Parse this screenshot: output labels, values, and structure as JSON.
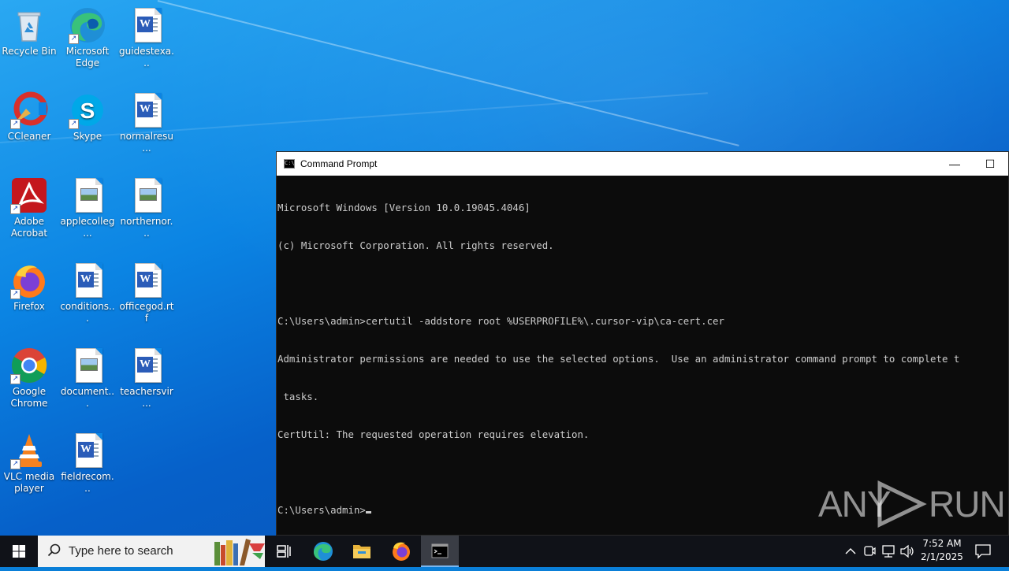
{
  "desktop": {
    "icons": [
      {
        "label": "Recycle Bin",
        "icon": "recycle-bin-icon"
      },
      {
        "label": "Microsoft Edge",
        "icon": "edge-icon"
      },
      {
        "label": "guidestexa...",
        "icon": "word-document-icon"
      },
      {
        "label": "CCleaner",
        "icon": "ccleaner-icon"
      },
      {
        "label": "Skype",
        "icon": "skype-icon"
      },
      {
        "label": "normalresu...",
        "icon": "word-document-icon"
      },
      {
        "label": "Adobe Acrobat",
        "icon": "adobe-acrobat-icon"
      },
      {
        "label": "applecolleg...",
        "icon": "image-file-icon"
      },
      {
        "label": "northernor...",
        "icon": "image-file-icon"
      },
      {
        "label": "Firefox",
        "icon": "firefox-icon"
      },
      {
        "label": "conditions...",
        "icon": "word-document-icon"
      },
      {
        "label": "officegod.rtf",
        "icon": "word-document-icon"
      },
      {
        "label": "Google Chrome",
        "icon": "chrome-icon"
      },
      {
        "label": "document...",
        "icon": "image-file-icon"
      },
      {
        "label": "teachersvir...",
        "icon": "word-document-icon"
      },
      {
        "label": "VLC media player",
        "icon": "vlc-icon"
      },
      {
        "label": "fieldrecom...",
        "icon": "word-document-icon"
      }
    ]
  },
  "cmd_window": {
    "title": "Command Prompt",
    "minimize_glyph": "—",
    "maximize_glyph": "☐",
    "lines": [
      "Microsoft Windows [Version 10.0.19045.4046]",
      "(c) Microsoft Corporation. All rights reserved.",
      "",
      "C:\\Users\\admin>certutil -addstore root %USERPROFILE%\\.cursor-vip\\ca-cert.cer",
      "Administrator permissions are needed to use the selected options.  Use an administrator command prompt to complete t",
      " tasks.",
      "CertUtil: The requested operation requires elevation.",
      ""
    ],
    "prompt": "C:\\Users\\admin>"
  },
  "watermark": {
    "left": "ANY",
    "right": "RUN"
  },
  "taskbar": {
    "search_placeholder": "Type here to search",
    "apps": [
      "task-view",
      "edge",
      "file-explorer",
      "firefox",
      "command-prompt"
    ],
    "clock_time": "7:52 AM",
    "clock_date": "2/1/2025"
  },
  "colors": {
    "console_bg": "#0c0c0c",
    "console_text": "#cccccc",
    "taskbar_bg": "#101218",
    "desktop_blue": "#0b84e3"
  }
}
